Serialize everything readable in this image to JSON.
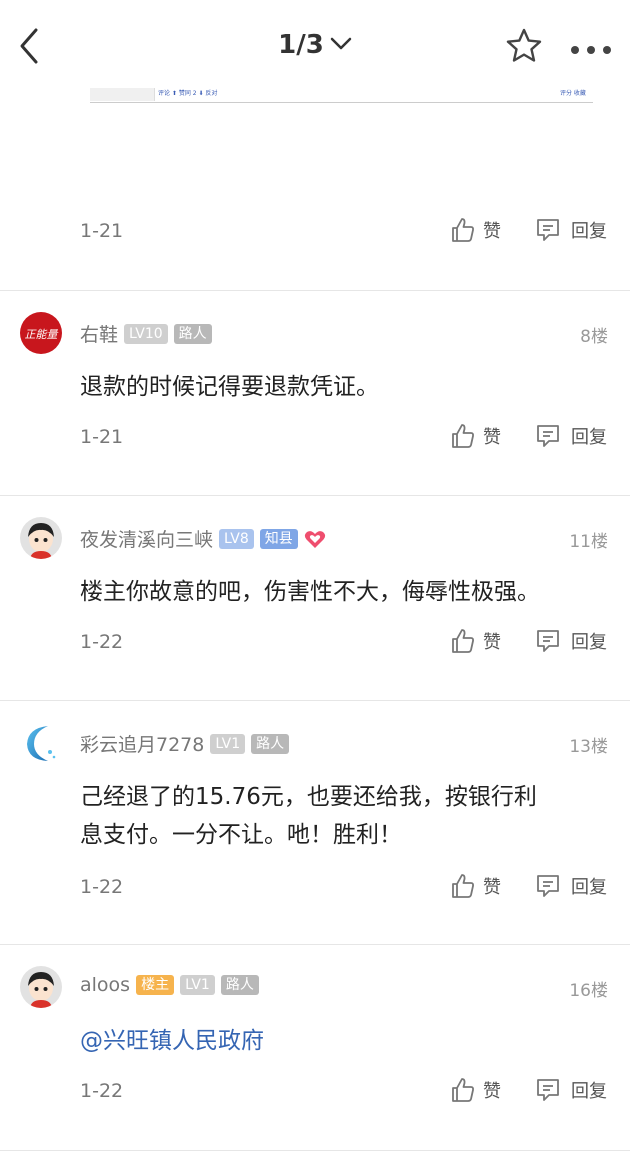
{
  "header": {
    "page_indicator": "1/3",
    "icons": [
      "back-arrow-icon",
      "chevron-down-icon",
      "star-icon",
      "more-icon"
    ]
  },
  "first_post": {
    "embed_left_text": "评论 ⬆ 赞同 2 ⬇ 反对",
    "embed_right_text": "评分 收藏",
    "date": "1-21",
    "like_label": "赞",
    "reply_label": "回复"
  },
  "posts": [
    {
      "username": "右鞋",
      "level": "LV10",
      "role": "路人",
      "floor": "8楼",
      "content": "退款的时候记得要退款凭证。",
      "date": "1-21",
      "like_label": "赞",
      "reply_label": "回复"
    },
    {
      "username": "夜发清溪向三峡",
      "level": "LV8",
      "role": "知县",
      "floor": "11楼",
      "content": "楼主你故意的吧，伤害性不大，侮辱性极强。",
      "date": "1-22",
      "like_label": "赞",
      "reply_label": "回复"
    },
    {
      "username": "彩云追月7278",
      "level": "LV1",
      "role": "路人",
      "floor": "13楼",
      "content_line1": "己经退了的15.76元，也要还给我，按银行利",
      "content_line2": "息支付。一分不让。吔！胜利！",
      "date": "1-22",
      "like_label": "赞",
      "reply_label": "回复"
    },
    {
      "username": "aloos",
      "host": "楼主",
      "level": "LV1",
      "role": "路人",
      "floor": "16楼",
      "content": "@兴旺镇人民政府",
      "date": "1-22",
      "like_label": "赞",
      "reply_label": "回复"
    }
  ],
  "colors": {
    "mention": "#3565b3",
    "host_badge": "#f6b34d",
    "role_blue_badge": "#7fa6e6",
    "heart": "#ef4e6e"
  }
}
